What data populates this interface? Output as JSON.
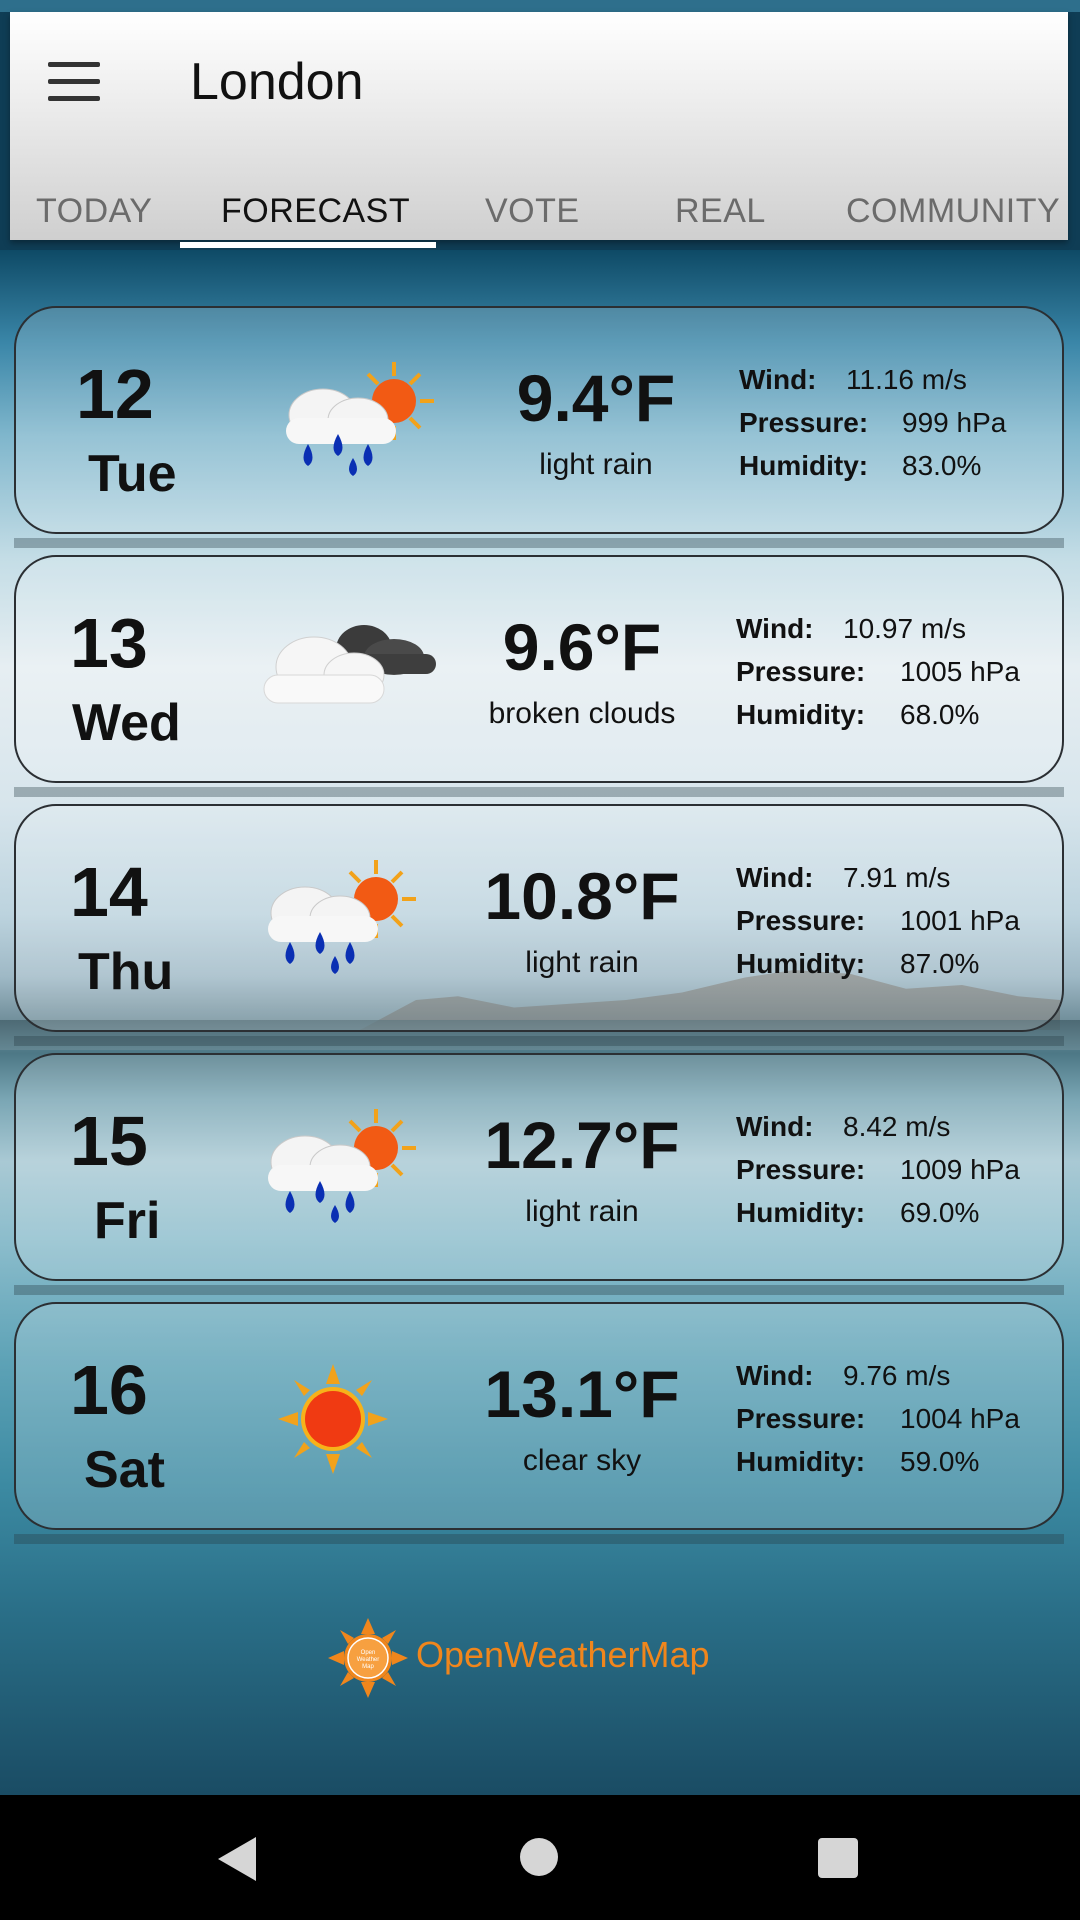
{
  "app_bar": {
    "title": "London",
    "tabs": [
      {
        "label": "TODAY"
      },
      {
        "label": "FORECAST"
      },
      {
        "label": "VOTE"
      },
      {
        "label": "REAL"
      },
      {
        "label": "COMMUNITY"
      }
    ],
    "active_tab": "FORECAST"
  },
  "labels": {
    "wind": "Wind:",
    "pressure": "Pressure:",
    "humidity": "Humidity:"
  },
  "forecast": [
    {
      "day_num": "12",
      "day_name": "Tue",
      "temp": "9.4°F",
      "desc": "light rain",
      "wind": "11.16 m/s",
      "pressure": "999 hPa",
      "humidity": "83.0%",
      "icon": "light-rain-sun-icon"
    },
    {
      "day_num": "13",
      "day_name": "Wed",
      "temp": "9.6°F",
      "desc": "broken clouds",
      "wind": "10.97 m/s",
      "pressure": "1005 hPa",
      "humidity": "68.0%",
      "icon": "broken-clouds-icon"
    },
    {
      "day_num": "14",
      "day_name": "Thu",
      "temp": "10.8°F",
      "desc": "light rain",
      "wind": "7.91 m/s",
      "pressure": "1001 hPa",
      "humidity": "87.0%",
      "icon": "light-rain-sun-icon"
    },
    {
      "day_num": "15",
      "day_name": "Fri",
      "temp": "12.7°F",
      "desc": "light rain",
      "wind": "8.42 m/s",
      "pressure": "1009 hPa",
      "humidity": "69.0%",
      "icon": "light-rain-sun-icon"
    },
    {
      "day_num": "16",
      "day_name": "Sat",
      "temp": "13.1°F",
      "desc": "clear sky",
      "wind": "9.76 m/s",
      "pressure": "1004 hPa",
      "humidity": "59.0%",
      "icon": "clear-sky-sun-icon"
    }
  ],
  "brand": {
    "name": "OpenWeatherMap",
    "logo_text": "Open Weather Map",
    "color": "#f0861c"
  },
  "nav": {
    "back_icon": "back-triangle-icon",
    "home_icon": "home-circle-icon",
    "recents_icon": "recents-square-icon"
  }
}
